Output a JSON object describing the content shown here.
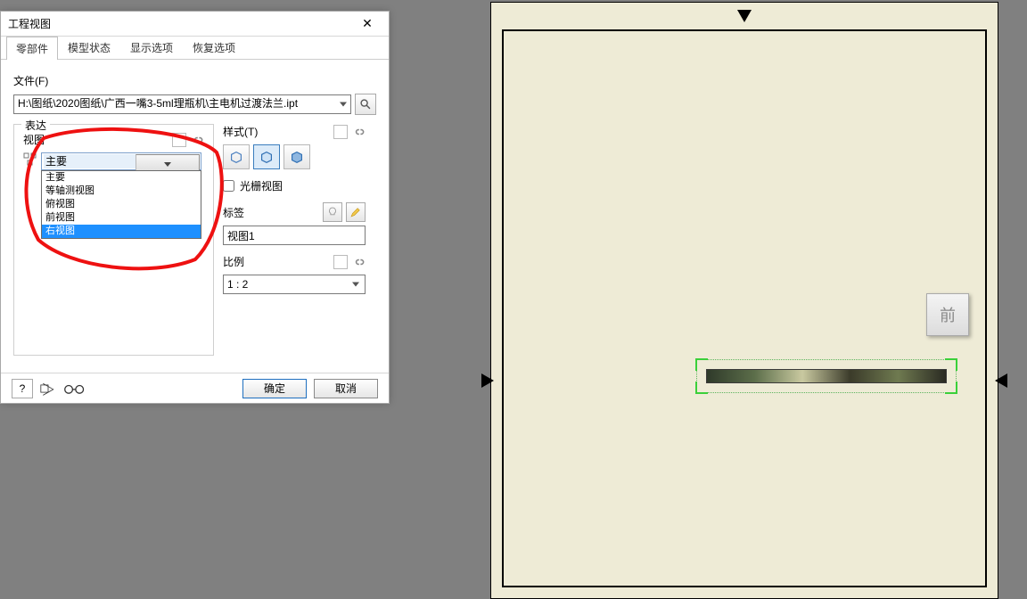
{
  "dialog": {
    "title": "工程视图",
    "tabs": [
      "零部件",
      "模型状态",
      "显示选项",
      "恢复选项"
    ],
    "active_tab": 0,
    "file_label": "文件(F)",
    "file_path": "H:\\图纸\\2020图纸\\广西一嘴3-5ml理瓶机\\主电机过渡法兰.ipt",
    "left_legend": "表达",
    "view_label": "视图",
    "view_selected": "主要",
    "view_options": [
      "主要",
      "等轴测视图",
      "俯视图",
      "前视图",
      "右视图"
    ],
    "view_highlight_index": 4,
    "right": {
      "style_label": "样式(T)",
      "raster_label": "光栅视图",
      "tag_label": "标签",
      "tag_value": "视图1",
      "scale_label": "比例",
      "scale_value": "1 : 2"
    }
  },
  "footer": {
    "ok": "确定",
    "cancel": "取消"
  },
  "viewcube": "前"
}
